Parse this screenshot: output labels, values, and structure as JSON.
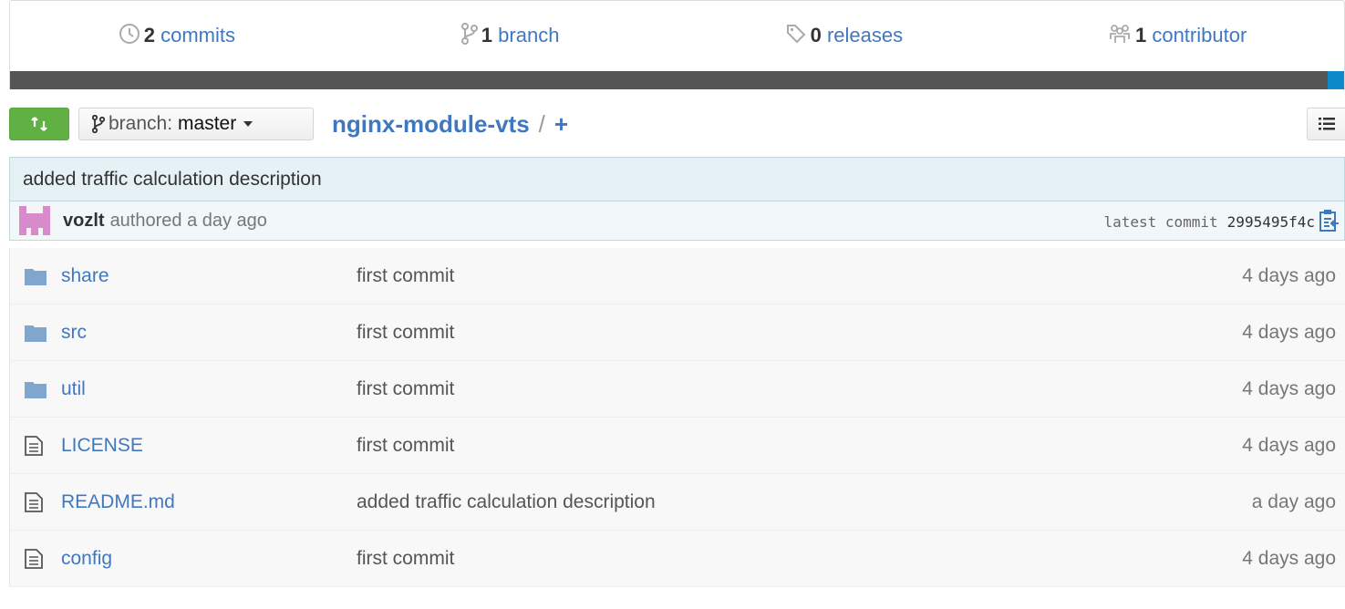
{
  "summary": {
    "commits": {
      "count": "2",
      "label": "commits",
      "icon": "history-icon"
    },
    "branches": {
      "count": "1",
      "label": "branch",
      "icon": "branch-icon"
    },
    "releases": {
      "count": "0",
      "label": "releases",
      "icon": "tag-icon"
    },
    "contributors": {
      "count": "1",
      "label": "contributor",
      "icon": "organization-icon"
    },
    "language_colors": [
      "#555555",
      "#0e8ac8"
    ]
  },
  "file_nav": {
    "branch_prefix": "branch:",
    "branch_name": "master",
    "repo_name": "nginx-module-vts",
    "separator": "/",
    "new_file": "+"
  },
  "commit": {
    "message": "added traffic calculation description",
    "author": "vozlt",
    "authored": "authored a day ago",
    "latest_label": "latest commit",
    "sha": "2995495f4c"
  },
  "files": [
    {
      "type": "directory",
      "name": "share",
      "message": "first commit",
      "age": "4 days ago"
    },
    {
      "type": "directory",
      "name": "src",
      "message": "first commit",
      "age": "4 days ago"
    },
    {
      "type": "directory",
      "name": "util",
      "message": "first commit",
      "age": "4 days ago"
    },
    {
      "type": "file",
      "name": "LICENSE",
      "message": "first commit",
      "age": "4 days ago"
    },
    {
      "type": "file",
      "name": "README.md",
      "message": "added traffic calculation description",
      "age": "a day ago"
    },
    {
      "type": "file",
      "name": "config",
      "message": "first commit",
      "age": "4 days ago"
    }
  ],
  "colors": {
    "link": "#4078c0",
    "compare_green": "#60b044",
    "commit_bg": "#e6f1f6"
  }
}
